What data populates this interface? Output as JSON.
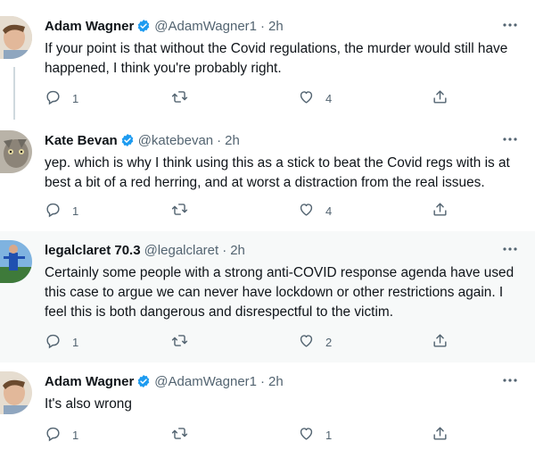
{
  "tweets": [
    {
      "name": "Adam Wagner",
      "verified": true,
      "handle": "@AdamWagner1",
      "time": "2h",
      "text": "If your point is that without the Covid regulations, the murder would still have happened, I think you're probably right.",
      "replies": "1",
      "retweets": "",
      "likes": "4"
    },
    {
      "name": "Kate Bevan",
      "verified": true,
      "handle": "@katebevan",
      "time": "2h",
      "text": "yep. which is why I think using this as a stick to beat the Covid regs with is at best a bit of a red herring, and at worst a distraction from the real issues.",
      "replies": "1",
      "retweets": "",
      "likes": "4"
    },
    {
      "name": "legalclaret 70.3",
      "verified": false,
      "handle": "@legalclaret",
      "time": "2h",
      "text": "Certainly some people with a strong anti-COVID response agenda have used this case to argue we can never have lockdown or other restrictions again. I feel this is both dangerous and disrespectful to the victim.",
      "replies": "1",
      "retweets": "",
      "likes": "2"
    },
    {
      "name": "Adam Wagner",
      "verified": true,
      "handle": "@AdamWagner1",
      "time": "2h",
      "text": "It's also wrong",
      "replies": "1",
      "retweets": "",
      "likes": "1"
    }
  ],
  "colors": {
    "verified": "#1d9bf0",
    "secondary_text": "#536471",
    "thread_line": "#cfd9de",
    "highlight_bg": "#f7f9f9"
  },
  "icons": [
    "verified-badge-icon",
    "more-options-icon",
    "reply-icon",
    "retweet-icon",
    "like-icon",
    "share-icon"
  ]
}
